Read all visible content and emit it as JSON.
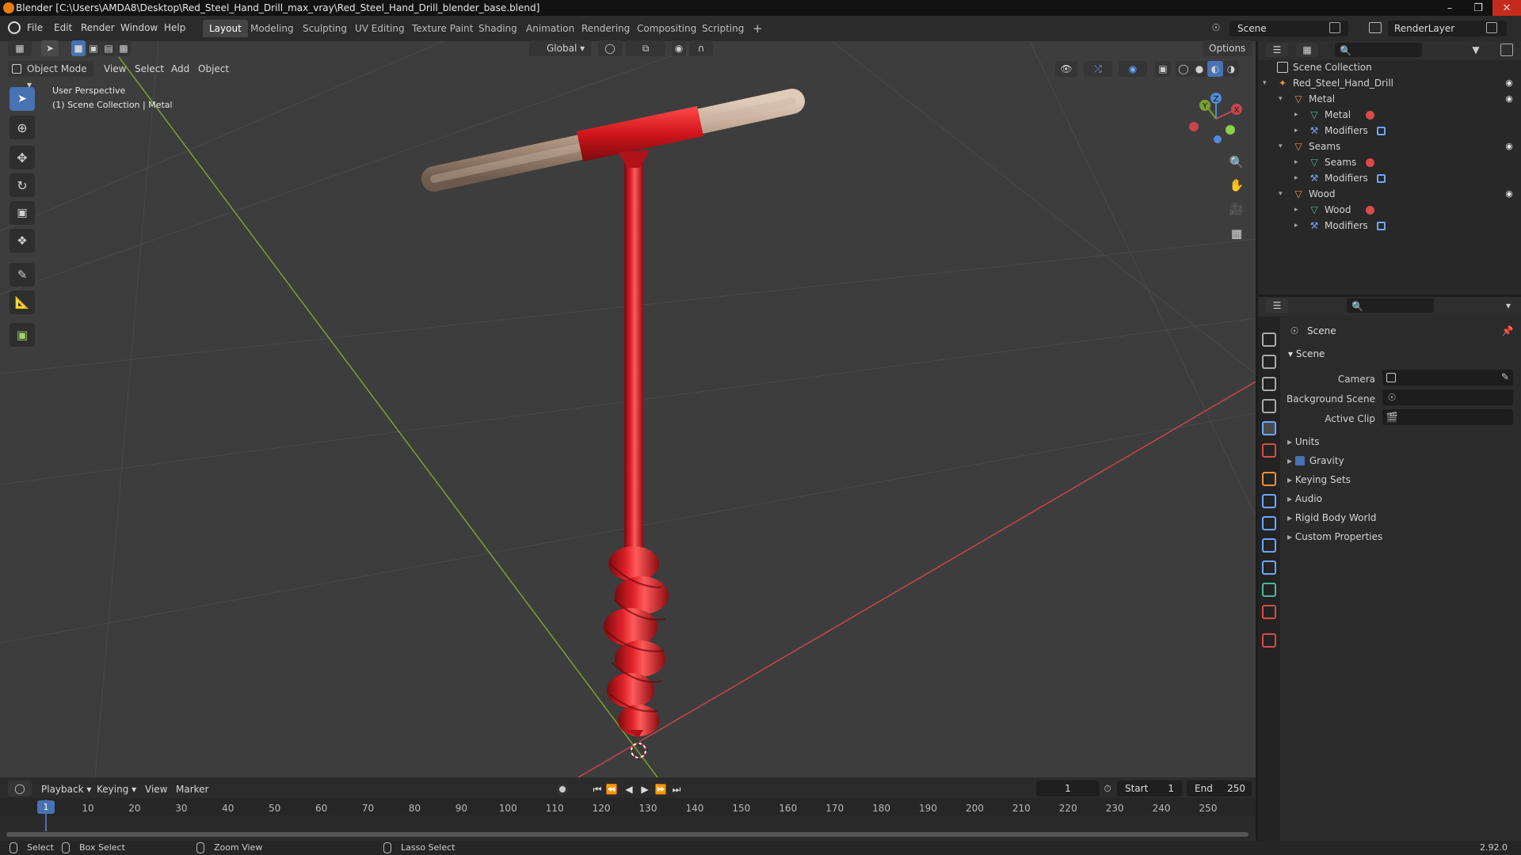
{
  "window": {
    "title": "Blender [C:\\Users\\AMDA8\\Desktop\\Red_Steel_Hand_Drill_max_vray\\Red_Steel_Hand_Drill_blender_base.blend]"
  },
  "menubar": {
    "items": [
      "File",
      "Edit",
      "Render",
      "Window",
      "Help"
    ]
  },
  "workspaces": {
    "tabs": [
      "Layout",
      "Modeling",
      "Sculpting",
      "UV Editing",
      "Texture Paint",
      "Shading",
      "Animation",
      "Rendering",
      "Compositing",
      "Scripting"
    ],
    "active": "Layout",
    "add": "+"
  },
  "scene_selector": {
    "value": "Scene"
  },
  "layer_selector": {
    "value": "RenderLayer"
  },
  "viewport": {
    "transform_orientation": "Global",
    "options_label": "Options",
    "mode": "Object Mode",
    "menus": [
      "View",
      "Select",
      "Add",
      "Object"
    ],
    "overlay_title": "User Perspective",
    "overlay_sub": "(1) Scene Collection | Metal",
    "gizmo": {
      "x": "X",
      "y": "Y",
      "z": "Z"
    }
  },
  "outliner": {
    "root": "Scene Collection",
    "rows": [
      {
        "label": "Red_Steel_Hand_Drill",
        "indent": 1,
        "icon": "empty"
      },
      {
        "label": "Metal",
        "indent": 2,
        "icon": "object"
      },
      {
        "label": "Metal",
        "indent": 3,
        "icon": "mesh"
      },
      {
        "label": "Modifiers",
        "indent": 3,
        "icon": "wrench"
      },
      {
        "label": "Seams",
        "indent": 2,
        "icon": "object"
      },
      {
        "label": "Seams",
        "indent": 3,
        "icon": "mesh"
      },
      {
        "label": "Modifiers",
        "indent": 3,
        "icon": "wrench"
      },
      {
        "label": "Wood",
        "indent": 2,
        "icon": "object"
      },
      {
        "label": "Wood",
        "indent": 3,
        "icon": "mesh"
      },
      {
        "label": "Modifiers",
        "indent": 3,
        "icon": "wrench"
      }
    ]
  },
  "properties": {
    "context": "Scene",
    "panel_title": "Scene",
    "camera_label": "Camera",
    "bg_scene_label": "Background Scene",
    "active_clip_label": "Active Clip",
    "panels": [
      "Units",
      "Gravity",
      "Keying Sets",
      "Audio",
      "Rigid Body World",
      "Custom Properties"
    ]
  },
  "timeline": {
    "menus": [
      "Playback",
      "Keying",
      "View",
      "Marker"
    ],
    "current_frame": "1",
    "start_label": "Start",
    "start_value": "1",
    "end_label": "End",
    "end_value": "250",
    "ticks": [
      "1",
      "10",
      "20",
      "30",
      "40",
      "50",
      "60",
      "70",
      "80",
      "90",
      "100",
      "110",
      "120",
      "130",
      "140",
      "150",
      "160",
      "170",
      "180",
      "190",
      "200",
      "210",
      "220",
      "230",
      "240",
      "250"
    ]
  },
  "statusbar": {
    "select": "Select",
    "box_select": "Box Select",
    "zoom_view": "Zoom View",
    "lasso_select": "Lasso Select",
    "version": "2.92.0"
  },
  "colors": {
    "accent": "#4772b3",
    "drill_red": "#d4141c",
    "wood": "#b49a86",
    "x_axis": "#c8454f",
    "y_axis": "#7aa12e"
  }
}
